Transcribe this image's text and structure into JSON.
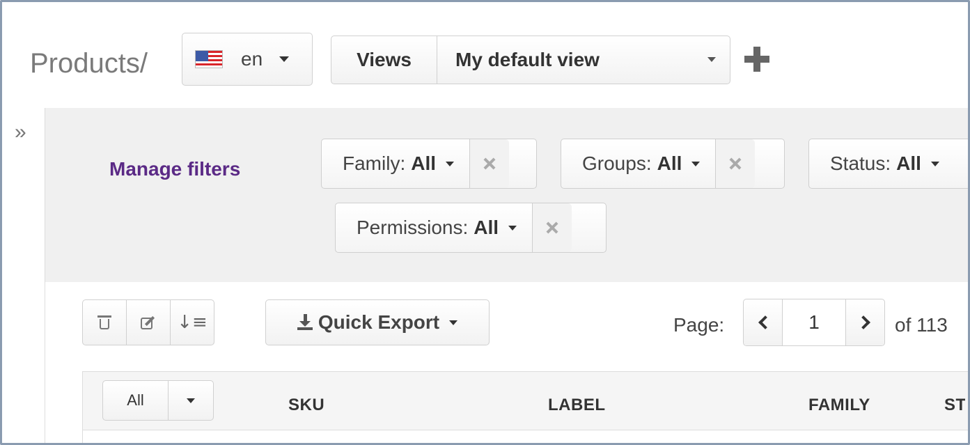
{
  "header": {
    "title": "Products",
    "separator": "/",
    "locale": {
      "code": "en",
      "flag_icon": "us-flag-icon"
    },
    "views": {
      "label": "Views",
      "selected": "My default view"
    },
    "add_view_icon": "plus-icon"
  },
  "sidebar": {
    "expand_icon": "double-chevron-right-icon",
    "expand_glyph": "»"
  },
  "filters": {
    "manage_label": "Manage filters",
    "items": [
      {
        "name": "Family:",
        "value": "All"
      },
      {
        "name": "Groups:",
        "value": "All"
      },
      {
        "name": "Status:",
        "value": "All"
      },
      {
        "name": "Permissions:",
        "value": "All"
      }
    ]
  },
  "toolbar": {
    "actions": [
      "trash-icon",
      "edit-icon",
      "sort-icon"
    ],
    "sort_glyph": "↓≡",
    "export_label": "Quick Export"
  },
  "pagination": {
    "label": "Page:",
    "current": "1",
    "total_text": "of 113"
  },
  "grid": {
    "select_all_label": "All",
    "columns": [
      "SKU",
      "LABEL",
      "FAMILY",
      "STATUS"
    ]
  },
  "colors": {
    "accent_link": "#5b2a86",
    "filter_bg": "#f0f0f0",
    "frame_border": "#8a9bb0"
  }
}
